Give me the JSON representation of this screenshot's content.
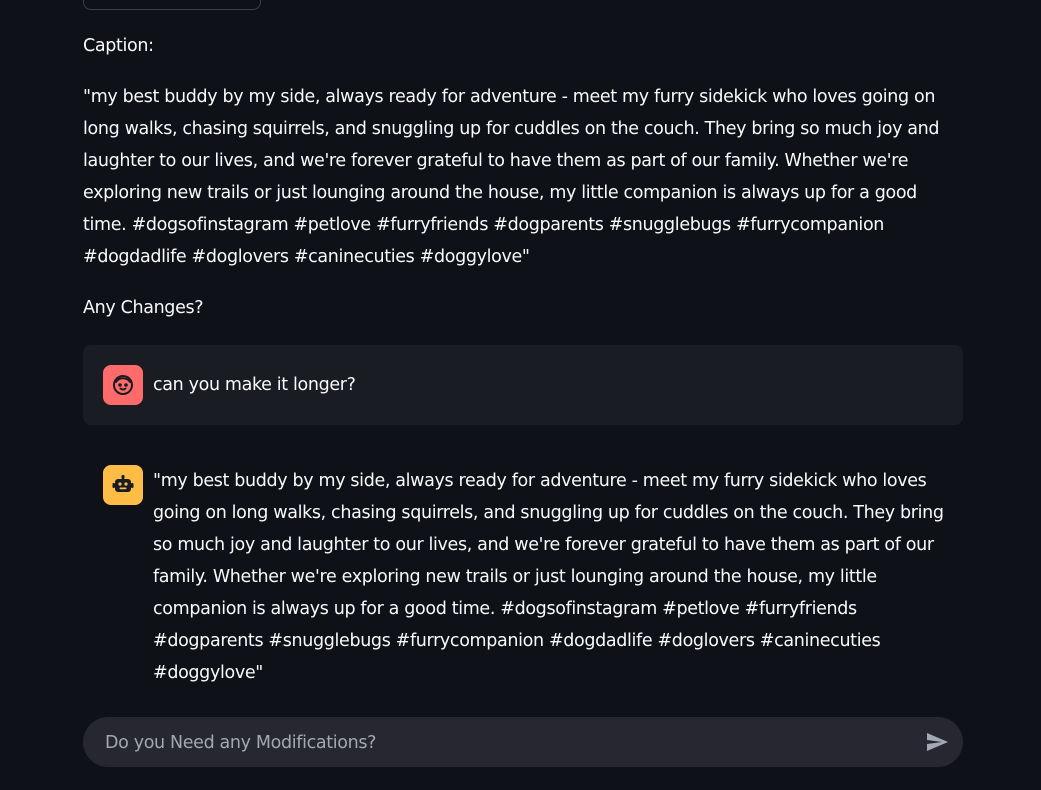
{
  "caption": {
    "label": "Caption:",
    "body": "\"my best buddy by my side, always ready for adventure - meet my furry sidekick who loves going on long walks, chasing squirrels, and snuggling up for cuddles on the couch. They bring so much joy and laughter to our lives, and we're forever grateful to have them as part of our family. Whether we're exploring new trails or just lounging around the house, my little companion is always up for a good time. #dogsofinstagram #petlove #furryfriends #dogparents #snugglebugs #furrycompanion #dogdadlife #doglovers #caninecuties #doggylove\""
  },
  "changes_label": "Any Changes?",
  "chat": {
    "user_message": "can you make it longer?",
    "assistant_message": "\"my best buddy by my side, always ready for adventure - meet my furry sidekick who loves going on long walks, chasing squirrels, and snuggling up for cuddles on the couch. They bring so much joy and laughter to our lives, and we're forever grateful to have them as part of our family. Whether we're exploring new trails or just lounging around the house, my little companion is always up for a good time. #dogsofinstagram #petlove #furryfriends #dogparents #snugglebugs #furrycompanion #dogdadlife #doglovers #caninecuties #doggylove\"",
    "user_avatar_icon": "user-face-icon",
    "assistant_avatar_icon": "robot-icon"
  },
  "input": {
    "placeholder": "Do you Need any Modifications?",
    "value": "",
    "send_icon": "send-icon"
  },
  "colors": {
    "background": "#0e1117",
    "user_avatar": "#ff6b6b",
    "assistant_avatar": "#ffbd45",
    "message_bg": "#1a1c24",
    "input_bg": "#262730"
  }
}
